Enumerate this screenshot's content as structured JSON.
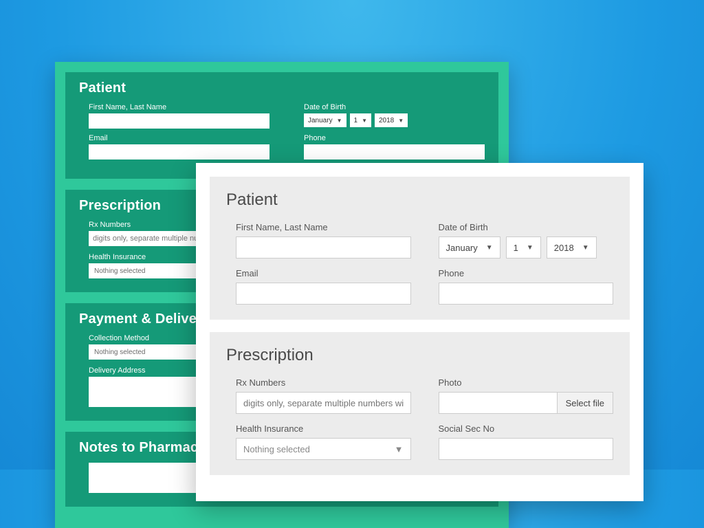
{
  "back": {
    "patient": {
      "title": "Patient",
      "name_label": "First Name, Last Name",
      "dob_label": "Date of Birth",
      "dob_month": "January",
      "dob_day": "1",
      "dob_year": "2018",
      "email_label": "Email",
      "phone_label": "Phone"
    },
    "prescription": {
      "title": "Prescription",
      "rx_label": "Rx Numbers",
      "rx_placeholder": "digits only, separate multiple numbers with commas",
      "hi_label": "Health Insurance",
      "hi_value": "Nothing selected"
    },
    "payment": {
      "title": "Payment & Delivery",
      "collect_label": "Collection Method",
      "collect_value": "Nothing selected",
      "addr_label": "Delivery Address"
    },
    "notes": {
      "title": "Notes to Pharmacy"
    }
  },
  "front": {
    "patient": {
      "title": "Patient",
      "name_label": "First Name, Last Name",
      "dob_label": "Date of Birth",
      "dob_month": "January",
      "dob_day": "1",
      "dob_year": "2018",
      "email_label": "Email",
      "phone_label": "Phone"
    },
    "prescription": {
      "title": "Prescription",
      "rx_label": "Rx Numbers",
      "rx_placeholder": "digits only, separate multiple numbers with commas",
      "photo_label": "Photo",
      "file_btn": "Select file",
      "hi_label": "Health Insurance",
      "hi_value": "Nothing selected",
      "ssn_label": "Social Sec No"
    }
  }
}
